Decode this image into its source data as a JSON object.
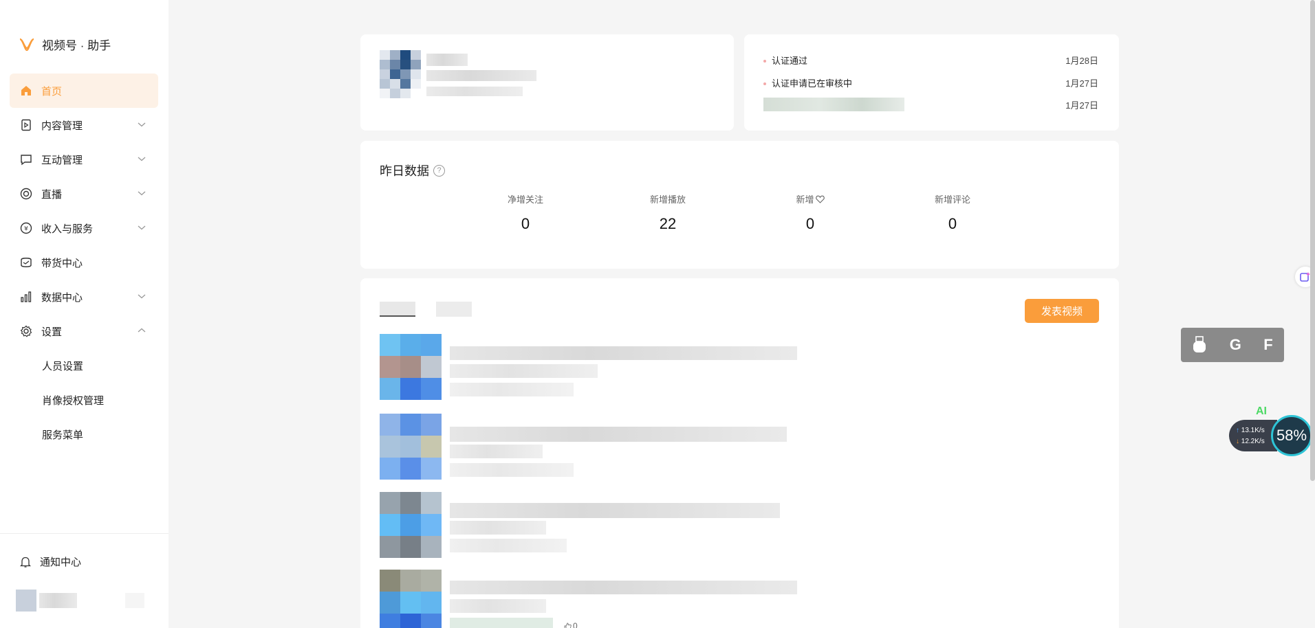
{
  "sidebar": {
    "logo_text": "视频号 · 助手",
    "items": [
      {
        "label": "首页",
        "icon": "home-icon",
        "active": true
      },
      {
        "label": "内容管理",
        "icon": "play-square-icon",
        "expandable": true
      },
      {
        "label": "互动管理",
        "icon": "chat-icon",
        "expandable": true
      },
      {
        "label": "直播",
        "icon": "live-icon",
        "expandable": true
      },
      {
        "label": "收入与服务",
        "icon": "yuan-icon",
        "expandable": true
      },
      {
        "label": "带货中心",
        "icon": "shop-icon"
      },
      {
        "label": "数据中心",
        "icon": "bar-chart-icon",
        "expandable": true
      },
      {
        "label": "设置",
        "icon": "gear-icon",
        "expanded": true
      }
    ],
    "sub_items": [
      "人员设置",
      "肖像授权管理",
      "服务菜单"
    ],
    "notify_label": "通知中心"
  },
  "notices": [
    {
      "text": "认证通过",
      "date": "1月28日"
    },
    {
      "text": "认证申请已在审核中",
      "date": "1月27日"
    },
    {
      "text": "",
      "date": "1月27日"
    }
  ],
  "stats": {
    "title": "昨日数据",
    "items": [
      {
        "label": "净增关注",
        "value": "0"
      },
      {
        "label": "新增播放",
        "value": "22"
      },
      {
        "label": "新增",
        "value": "0",
        "icon": "heart-icon"
      },
      {
        "label": "新增评论",
        "value": "0"
      }
    ]
  },
  "works": {
    "publish_label": "发表视频",
    "last_like_count": "0"
  },
  "widgets": {
    "toolbar_letters": [
      "G",
      "F"
    ],
    "ai_label": "AI",
    "upload_speed": "13.1K/s",
    "download_speed": "12.2K/s",
    "gauge_value": "58%"
  },
  "colors": {
    "accent": "#fa9d3b",
    "active_bg": "#fdf1e6"
  }
}
